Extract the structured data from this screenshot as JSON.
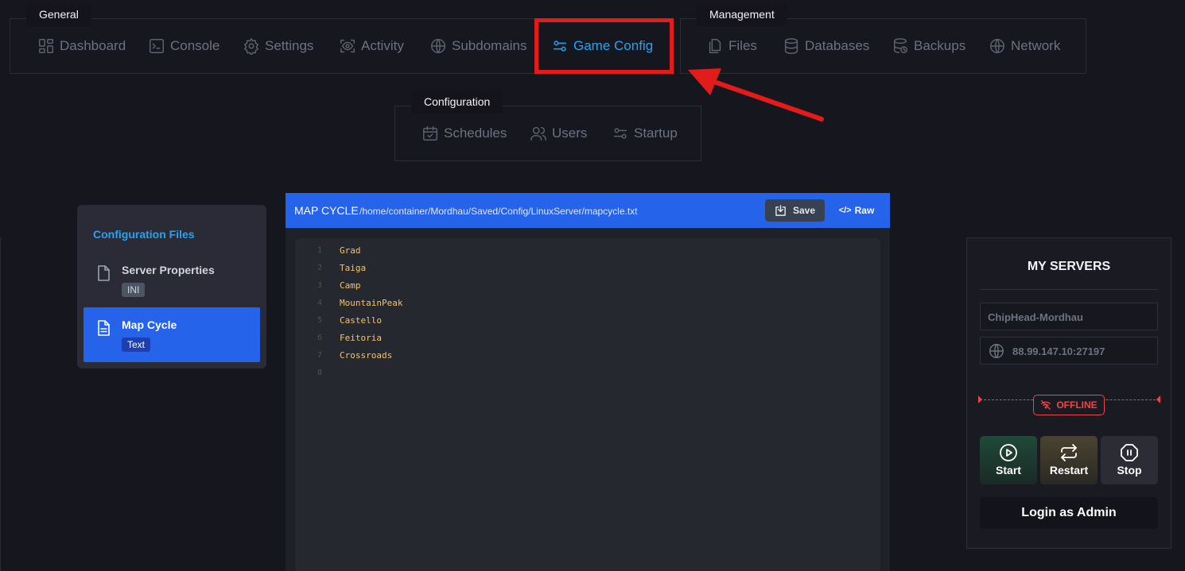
{
  "nav": {
    "general": {
      "label": "General",
      "items": [
        {
          "label": "Dashboard",
          "icon": "dashboard-icon"
        },
        {
          "label": "Console",
          "icon": "terminal-icon"
        },
        {
          "label": "Settings",
          "icon": "gear-icon"
        },
        {
          "label": "Activity",
          "icon": "eye-icon"
        },
        {
          "label": "Subdomains",
          "icon": "globe-icon"
        },
        {
          "label": "Game Config",
          "icon": "sliders-icon",
          "active": true
        }
      ]
    },
    "management": {
      "label": "Management",
      "items": [
        {
          "label": "Files",
          "icon": "files-icon"
        },
        {
          "label": "Databases",
          "icon": "database-icon"
        },
        {
          "label": "Backups",
          "icon": "backup-icon"
        },
        {
          "label": "Network",
          "icon": "globe-icon"
        }
      ]
    },
    "configuration": {
      "label": "Configuration",
      "items": [
        {
          "label": "Schedules",
          "icon": "calendar-icon"
        },
        {
          "label": "Users",
          "icon": "users-icon"
        },
        {
          "label": "Startup",
          "icon": "sliders-icon"
        }
      ]
    }
  },
  "sidebar": {
    "title": "Configuration Files",
    "files": [
      {
        "name": "Server Properties",
        "tag": "INI",
        "active": false
      },
      {
        "name": "Map Cycle",
        "tag": "Text",
        "active": true
      }
    ]
  },
  "editor": {
    "title": "MAP CYCLE",
    "path": "/home/container/Mordhau/Saved/Config/LinuxServer/mapcycle.txt",
    "save_label": "Save",
    "raw_label": "Raw",
    "lines": [
      "Grad",
      "Taiga",
      "Camp",
      "MountainPeak",
      "Castello",
      "Feitoria",
      "Crossroads",
      ""
    ]
  },
  "servers": {
    "title": "MY SERVERS",
    "server_name": "ChipHead-Mordhau",
    "address": "88.99.147.10:27197",
    "status": "OFFLINE",
    "start_label": "Start",
    "restart_label": "Restart",
    "stop_label": "Stop",
    "login_label": "Login as Admin"
  },
  "colors": {
    "accent": "#22a4f5",
    "primary": "#2563eb",
    "highlight": "#e21b1b",
    "offline": "#ef4444"
  }
}
